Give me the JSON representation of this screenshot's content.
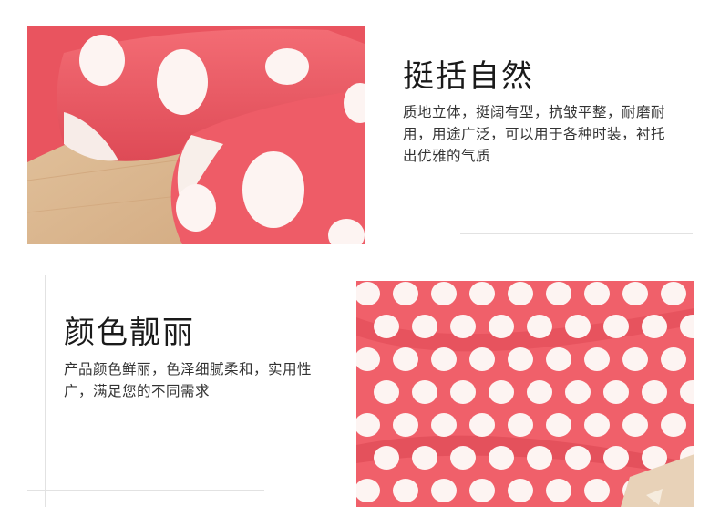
{
  "sections": [
    {
      "title": "挺括自然",
      "description": "质地立体，挺阔有型，抗皱平整，耐磨耐用，用途广泛，可以用于各种时装，衬托出优雅的气质"
    },
    {
      "title": "颜色靓丽",
      "description": "产品颜色鲜丽，色泽细腻柔和，实用性广，满足您的不同需求"
    }
  ],
  "colors": {
    "fabric": "#f0606a",
    "fabric_shadow": "#d9434f",
    "dot": "#fdf4f2",
    "wood": "#d9b58e"
  }
}
